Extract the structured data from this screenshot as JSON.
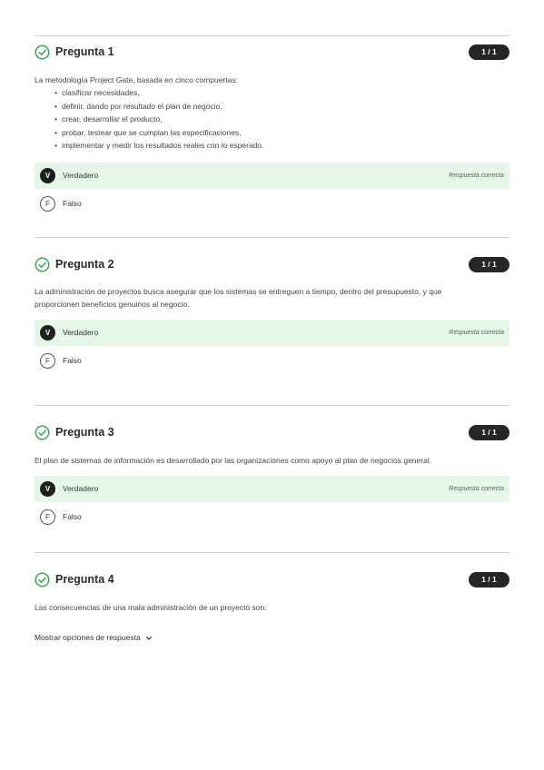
{
  "questions": [
    {
      "title": "Pregunta 1",
      "score": "1 / 1",
      "text": "La metodología Project Gate, basada en cinco compuertas:",
      "bullets": [
        "clasificar necesidades,",
        "definir, dando por resultado el plan de negocio,",
        "crear, desarrollar el producto,",
        "probar, testear que se cumplan las especificaciones,",
        "implementar y medir los resultados reales con lo esperado."
      ],
      "options": [
        {
          "badge": "V",
          "label": "Verdadero",
          "note": "Respuesta correcta",
          "correct": true
        },
        {
          "badge": "F",
          "label": "Falso",
          "note": "",
          "correct": false
        }
      ]
    },
    {
      "title": "Pregunta 2",
      "score": "1 / 1",
      "text_lines": [
        "La administración de proyectos busca asegurar que los sistemas se entreguen a tiempo, dentro del presupuesto, y que",
        "proporcionen beneficios genuinos al negocio."
      ],
      "options": [
        {
          "badge": "V",
          "label": "Verdadero",
          "note": "Respuesta correcta",
          "correct": true
        },
        {
          "badge": "F",
          "label": "Falso",
          "note": "",
          "correct": false
        }
      ]
    },
    {
      "title": "Pregunta 3",
      "score": "1 / 1",
      "text": "El plan de sistemas de información es desarrollado por las organizaciones como apoyo al plan de negocios general.",
      "options": [
        {
          "badge": "V",
          "label": "Verdadero",
          "note": "Respuesta correcta",
          "correct": true
        },
        {
          "badge": "F",
          "label": "Falso",
          "note": "",
          "correct": false
        }
      ]
    },
    {
      "title": "Pregunta 4",
      "score": "1 / 1",
      "text": "Las consecuencias de una mala administración de un proyecto son:",
      "show_options_label": "Mostrar opciones de respuesta"
    }
  ],
  "icons": {
    "question_status": "check-circle-icon",
    "expand": "chevron-down-icon"
  },
  "colors": {
    "success_green": "#34a853",
    "correct_row_bg": "#e6f7ea",
    "score_pill_bg": "#262626"
  }
}
